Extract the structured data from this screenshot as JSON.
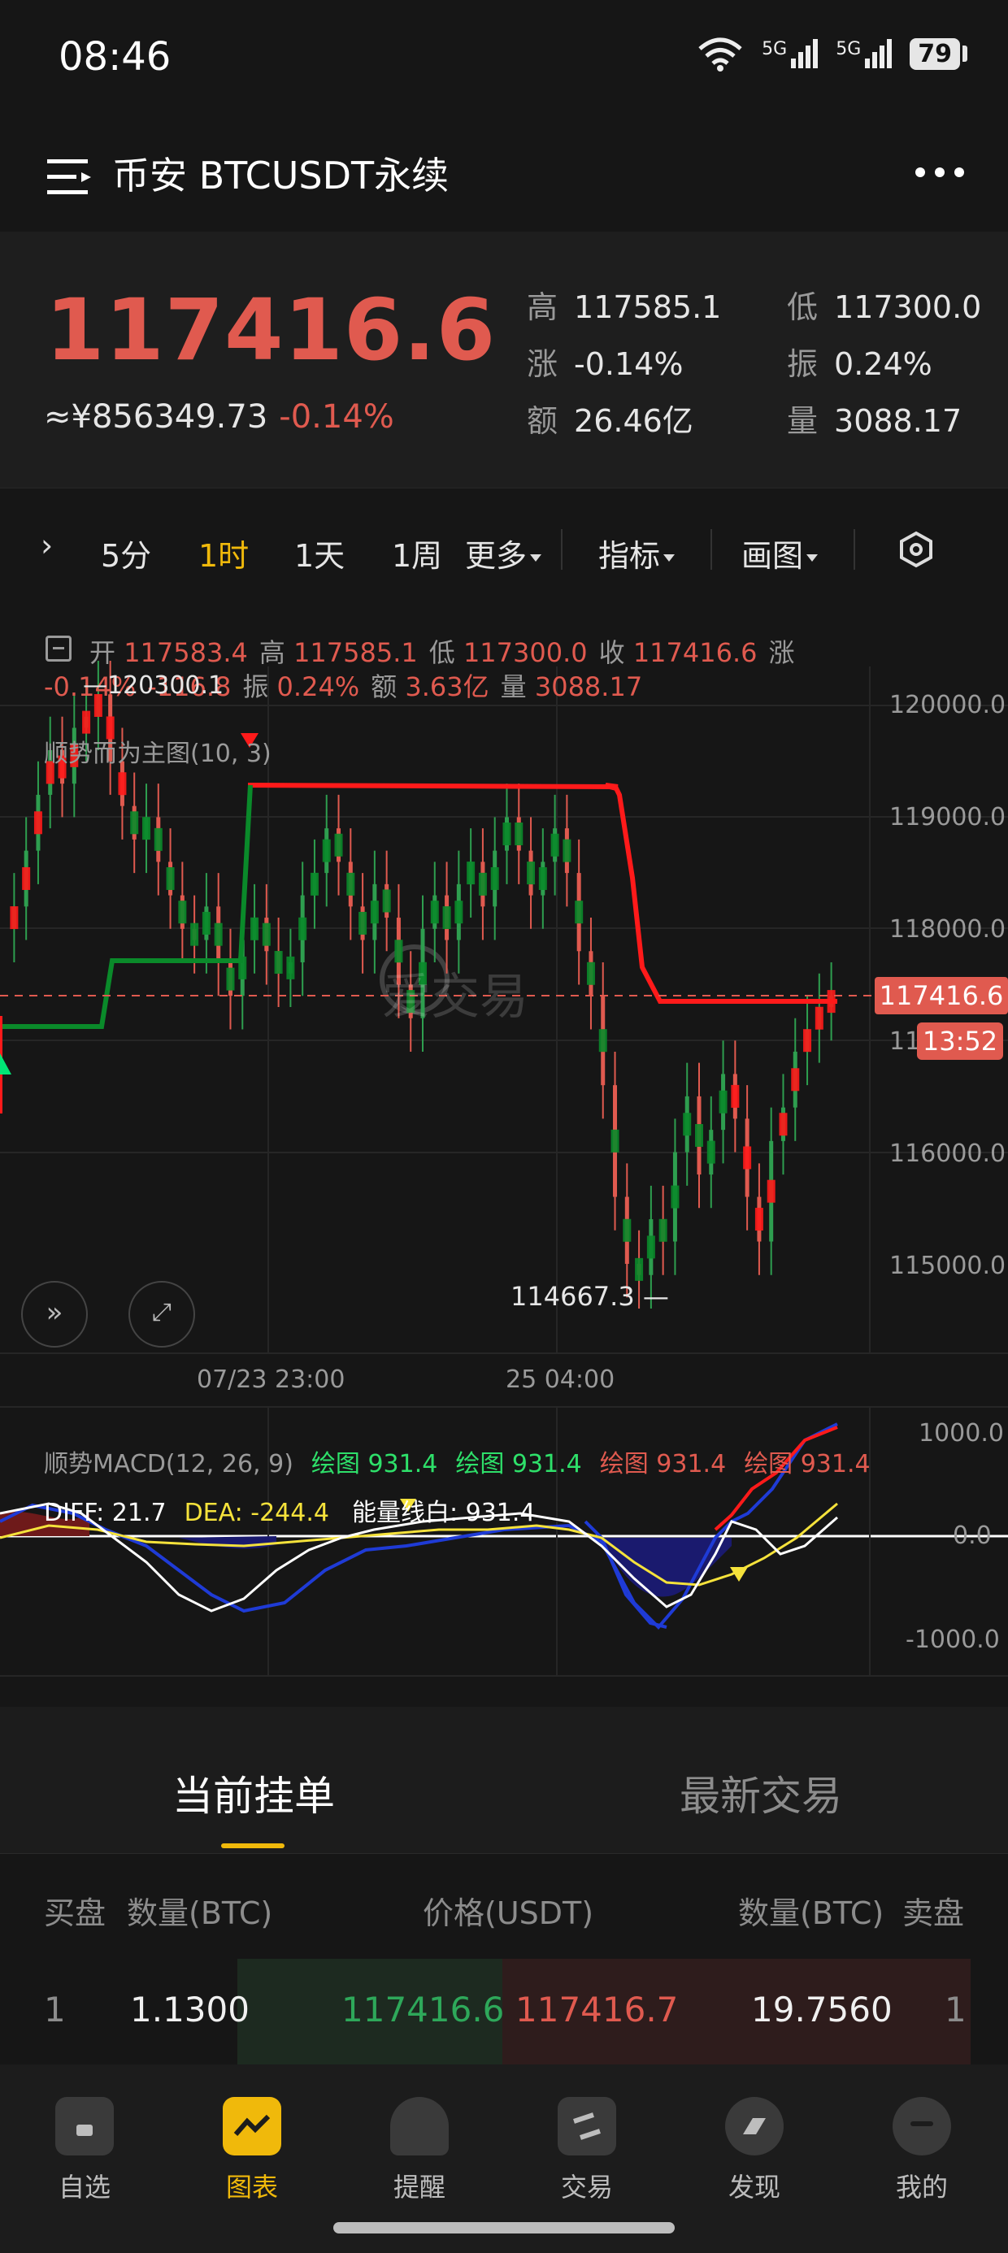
{
  "status": {
    "time": "08:46",
    "net1": "5G",
    "net2": "5G",
    "battery": "79"
  },
  "header": {
    "title": "币安 BTCUSDT永续"
  },
  "ticker": {
    "price": "117416.6",
    "cny": "≈¥856349.73",
    "change": "-0.14%",
    "stats": [
      {
        "k": "高",
        "v": "117585.1"
      },
      {
        "k": "低",
        "v": "117300.0"
      },
      {
        "k": "涨",
        "v": "-0.14%"
      },
      {
        "k": "振",
        "v": "0.24%"
      },
      {
        "k": "额",
        "v": "26.46亿"
      },
      {
        "k": "量",
        "v": "3088.17"
      }
    ]
  },
  "timeframes": [
    {
      "label": "5分",
      "active": false
    },
    {
      "label": "1时",
      "active": true
    },
    {
      "label": "1天",
      "active": false
    },
    {
      "label": "1周",
      "active": false
    },
    {
      "label": "更多",
      "active": false
    }
  ],
  "tools": {
    "indicator": "指标",
    "draw": "画图"
  },
  "ohlc": {
    "open_k": "开",
    "open": "117583.4",
    "high_k": "高",
    "high": "117585.1",
    "low_k": "低",
    "low": "117300.0",
    "close_k": "收",
    "close": "117416.6",
    "chg_k": "涨",
    "chg": "-0.14%",
    "chgv": "-116.8",
    "amp_k": "振",
    "amp": "0.24%",
    "amt_k": "额",
    "amt": "3.63亿",
    "vol_k": "量",
    "vol": "3088.17"
  },
  "chart_data": {
    "type": "line",
    "indicator_label": "顺势而为主图(10, 3)",
    "y_ticks": [
      "120000.0",
      "119000.0",
      "118000.0",
      "116000.0",
      "115000.0"
    ],
    "partial_tick": "11",
    "x_ticks": [
      "07/23 23:00",
      "25 04:00"
    ],
    "last_price": "117416.6",
    "countdown": "13:52",
    "high_marker": "120300.1",
    "low_marker": "114667.3",
    "watermark": "爱交易",
    "colors": {
      "up": "#2e9e4f",
      "down": "#e05a4f",
      "trend_up": "#00c853",
      "trend_down": "#ff1a1a"
    }
  },
  "macd": {
    "title": "顺势MACD(12, 26, 9)",
    "p1": "绘图 931.4",
    "p2": "绘图 931.4",
    "p3": "绘图 931.4",
    "p4": "绘图 931.4",
    "diff": "DIFF: 21.7",
    "dea": "DEA: -244.4",
    "energy": "能量线白: 931.4",
    "y_ticks": [
      "1000.0",
      "0.0",
      "-1000.0"
    ]
  },
  "orderbook": {
    "tab_orders": "当前挂单",
    "tab_trades": "最新交易",
    "head": {
      "buy": "买盘",
      "qty": "数量(BTC)",
      "price": "价格(USDT)",
      "qty2": "数量(BTC)",
      "sell": "卖盘"
    },
    "row": {
      "idx": "1",
      "bid_qty": "1.1300",
      "bid": "117416.6",
      "ask": "117416.7",
      "ask_qty": "19.7560",
      "idx2": "1"
    }
  },
  "nav": [
    {
      "label": "自选",
      "icon": "watchlist-icon"
    },
    {
      "label": "图表",
      "icon": "chart-icon"
    },
    {
      "label": "提醒",
      "icon": "bell-icon"
    },
    {
      "label": "交易",
      "icon": "trade-icon"
    },
    {
      "label": "发现",
      "icon": "discover-icon"
    },
    {
      "label": "我的",
      "icon": "profile-icon"
    }
  ]
}
